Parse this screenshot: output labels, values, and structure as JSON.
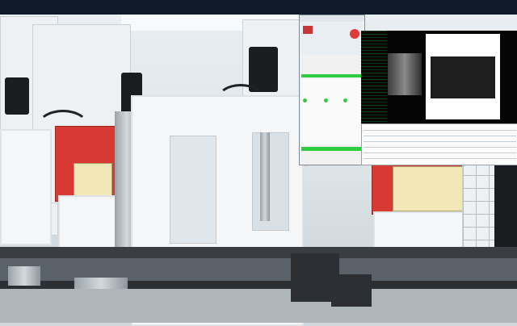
{
  "scene": {
    "subject": "",
    "note": ""
  }
}
